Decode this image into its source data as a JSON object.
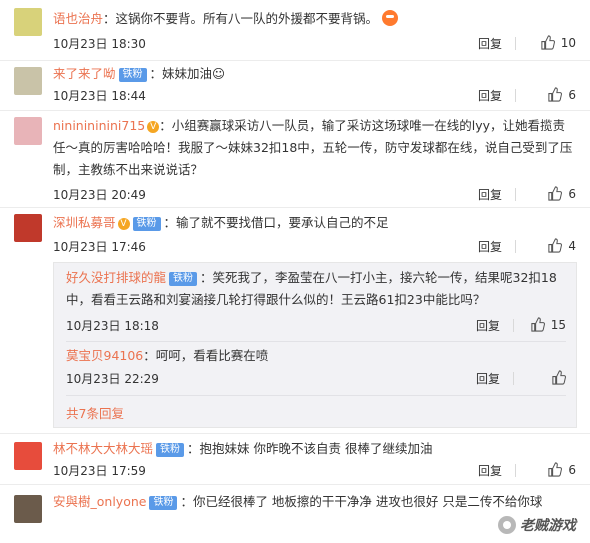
{
  "comments": [
    {
      "username": "语也治舟",
      "text": "：这锅你不要背。所有八一队的外援都不要背锅。",
      "time": "10月23日 18:30",
      "reply_label": "回复",
      "likes": "10",
      "avatar_color": "#d8d27a"
    },
    {
      "username": "来了来了呦",
      "badge": "铁粉",
      "text": "：妹妹加油☺",
      "time": "10月23日 18:44",
      "reply_label": "回复",
      "likes": "6",
      "avatar_color": "#c9c3a8"
    },
    {
      "username": "nininininini715",
      "text": "：小组赛赢球采访八一队员，输了采访这场球唯一在线的lyy，让她看揽责任～真的厉害哈哈哈！我服了～妹妹32扣18中，五轮一传，防守发球都在线，说自己受到了压制，主教练不出来说说话？",
      "time": "10月23日 20:49",
      "reply_label": "回复",
      "likes": "6",
      "avatar_color": "#e8b4b8"
    },
    {
      "username": "深圳私募哥",
      "badge": "铁粉",
      "text": "：输了就不要找借口，要承认自己的不足",
      "time": "10月23日 17:46",
      "reply_label": "回复",
      "likes": "4",
      "avatar_color": "#c0392b"
    },
    {
      "username": "林不林大大林大瑶",
      "badge": "铁粉",
      "text": "：抱抱妹妹 你昨晚不该自责 很棒了继续加油",
      "time": "10月23日 17:59",
      "reply_label": "回复",
      "likes": "6",
      "avatar_color": "#e74c3c"
    },
    {
      "username": "安與樹_onlyone",
      "badge": "铁粉",
      "text": "：你已经很棒了 地板擦的干干净净 进攻也很好 只是二传不给你球",
      "avatar_color": "#6b5b4b"
    }
  ],
  "sub_replies": [
    {
      "username": "好久没打排球的龍",
      "badge": "铁粉",
      "text": "：笑死我了，李盈莹在八一打小主，接六轮一传，结果呢32扣18中，看看王云路和刘宴涵接几轮打得跟什么似的！王云路61扣23中能比吗？",
      "time": "10月23日 18:18",
      "reply_label": "回复",
      "likes": "15"
    },
    {
      "username": "莫宝贝94106",
      "text": "：呵呵，看看比赛在喷",
      "time": "10月23日 22:29",
      "reply_label": "回复",
      "likes": ""
    }
  ],
  "more_replies_label": "共7条回复",
  "watermark_text": "老贼游戏"
}
